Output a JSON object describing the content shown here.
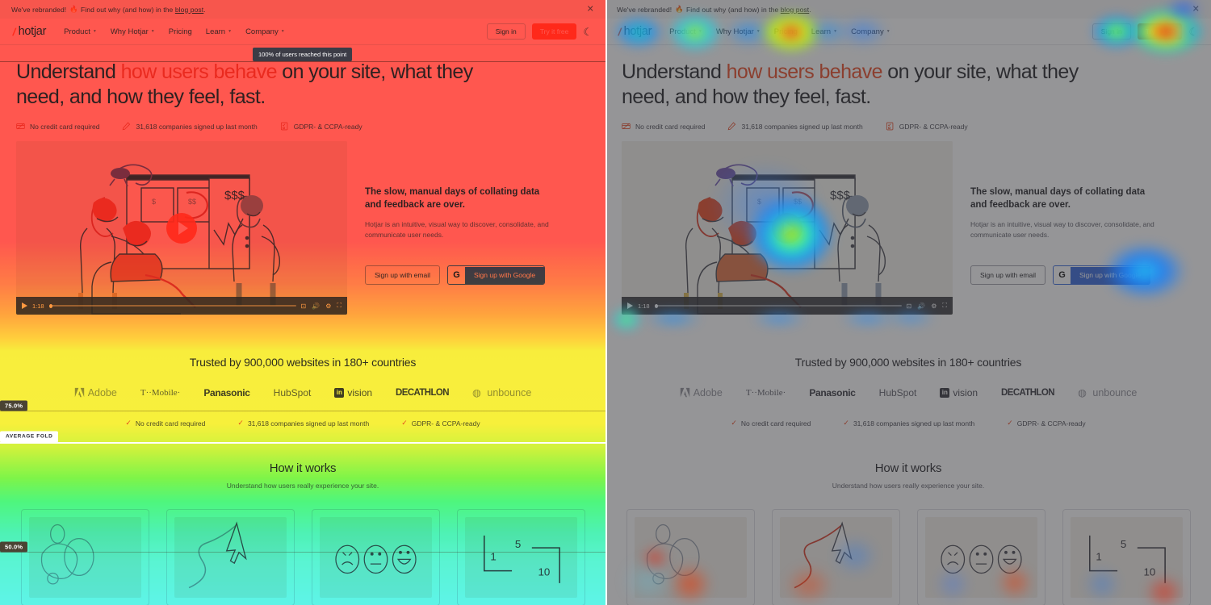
{
  "comparison": {
    "left_mode": "scroll-heatmap",
    "right_mode": "click-heatmap",
    "scroll_tooltip": "100% of users reached this point",
    "markers": [
      {
        "label": "75.0%",
        "type": "depth"
      },
      {
        "label": "AVERAGE FOLD",
        "type": "fold"
      },
      {
        "label": "50.0%",
        "type": "depth"
      }
    ],
    "colors": {
      "scroll_top": "#ff2b1f",
      "scroll_mid": "#f6ed06",
      "scroll_bottom": "#33f2e2",
      "click_hot": "#d8321e",
      "click_warm": "#f2e81c",
      "click_cool": "#1f6ef2"
    }
  },
  "banner": {
    "text_before": "We've rebranded!",
    "flame": "🔥",
    "text_mid": "Find out why (and how) in the",
    "link": "blog post",
    "text_after": ".",
    "close_icon": "close-icon"
  },
  "nav": {
    "logo_mark": "/",
    "logo_text": "hotjar",
    "links": [
      {
        "label": "Product",
        "has_caret": true
      },
      {
        "label": "Why Hotjar",
        "has_caret": true
      },
      {
        "label": "Pricing",
        "has_caret": false
      },
      {
        "label": "Learn",
        "has_caret": true
      },
      {
        "label": "Company",
        "has_caret": true
      }
    ],
    "sign_in": "Sign in",
    "try_free": "Try it free",
    "theme_icon": "moon-icon"
  },
  "hero": {
    "heading_part1": "Understand ",
    "heading_highlight": "how users behave",
    "heading_part2": " on your site, what they need, and how they feel, fast.",
    "features": [
      {
        "icon": "credit-card-icon",
        "label": "No credit card required"
      },
      {
        "icon": "pen-icon",
        "label": "31,618 companies signed up last month"
      },
      {
        "icon": "shield-check-icon",
        "label": "GDPR- & CCPA-ready"
      }
    ]
  },
  "video": {
    "time": "1:18",
    "play_icon": "play-icon",
    "controls": [
      "play-icon",
      "cc-icon",
      "volume-icon",
      "settings-icon",
      "fullscreen-icon"
    ],
    "dollar_signs": "$$$",
    "small_dollar": "$"
  },
  "copy": {
    "heading": "The slow, manual days of collating data and feedback are over.",
    "body": "Hotjar is an intuitive, visual way to discover, consolidate, and communicate user needs.",
    "cta_email": "Sign up with email",
    "cta_google": "Sign up with Google",
    "google_letter": "G"
  },
  "trusted": {
    "heading": "Trusted by 900,000 websites in 180+ countries",
    "logos": [
      "Adobe",
      "T··Mobile·",
      "Panasonic",
      "HubSpot",
      "vision",
      "DECATHLON",
      "unbounce"
    ],
    "invision_mark": "in",
    "checks": [
      "No credit card required",
      "31,618 companies signed up last month",
      "GDPR- & CCPA-ready"
    ]
  },
  "how": {
    "heading": "How it works",
    "subheading": "Understand how users really experience your site.",
    "cards": [
      {
        "name": "heatmaps-card",
        "art": "blobs"
      },
      {
        "name": "recordings-card",
        "art": "cursor"
      },
      {
        "name": "feedback-card",
        "art": "faces"
      },
      {
        "name": "surveys-card",
        "art": "scale"
      }
    ],
    "scale_numbers": [
      "1",
      "5",
      "10"
    ]
  }
}
